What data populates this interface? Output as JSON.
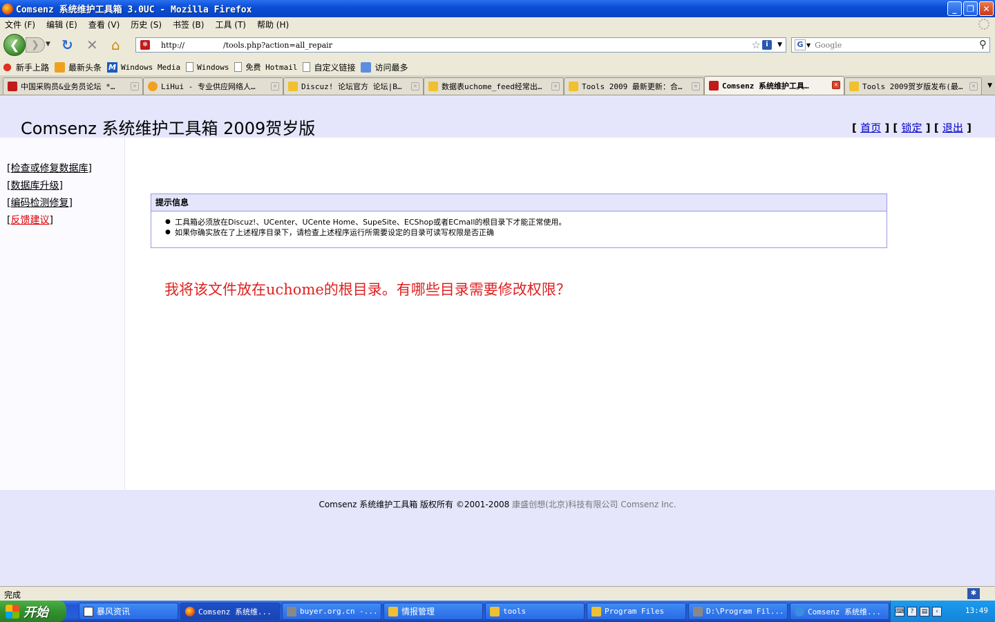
{
  "window": {
    "title": "Comsenz 系统维护工具箱 3.0UC - Mozilla Firefox",
    "buttons": {
      "minimize": "_",
      "maximize": "❐",
      "close": "✕"
    }
  },
  "menu": [
    "文件 (F)",
    "编辑 (E)",
    "查看 (V)",
    "历史 (S)",
    "书签 (B)",
    "工具 (T)",
    "帮助 (H)"
  ],
  "navbar": {
    "url": "http://                /tools.php?action=all_repair",
    "search_placeholder": "Google",
    "search_engine_icon": "G"
  },
  "bookmarks": [
    {
      "label": "新手上路",
      "icon": "red"
    },
    {
      "label": "最新头条",
      "icon": "rss"
    },
    {
      "label": "Windows Media",
      "icon": "wm",
      "mono": true
    },
    {
      "label": "Windows",
      "icon": "page",
      "mono": true
    },
    {
      "label": "免费 Hotmail",
      "icon": "page",
      "mono": true
    },
    {
      "label": "自定义链接",
      "icon": "page"
    },
    {
      "label": "访问最多",
      "icon": "folder"
    }
  ],
  "tabs": [
    {
      "title": "中国采购员&业务员论坛 *…",
      "icon": "dz",
      "active": false
    },
    {
      "title": "LiHui - 专业供应网络人…",
      "icon": "home",
      "active": false
    },
    {
      "title": "Discuz! 论坛官方 论坛|B…",
      "icon": "folder",
      "active": false
    },
    {
      "title": "数据表uchome_feed经常出…",
      "icon": "folder",
      "active": false
    },
    {
      "title": "Tools 2009 最新更新：合…",
      "icon": "folder",
      "active": false
    },
    {
      "title": "Comsenz 系统维护工具…",
      "icon": "dz",
      "active": true
    },
    {
      "title": "Tools 2009贺岁版发布(最…",
      "icon": "folder",
      "active": false
    }
  ],
  "page": {
    "title": "Comsenz 系统维护工具箱 2009贺岁版",
    "top_links": {
      "home": "首页",
      "lock": "锁定",
      "logout": "退出"
    },
    "sidebar": [
      {
        "label": "检查或修复数据库",
        "feedback": false
      },
      {
        "label": "数据库升级",
        "feedback": false
      },
      {
        "label": "编码检测修复",
        "feedback": false
      },
      {
        "label": "反馈建议",
        "feedback": true
      }
    ],
    "notice": {
      "heading": "提示信息",
      "items": [
        "工具箱必须放在Discuz!、UCenter、UCente Home、SupeSite、ECShop或者ECmall的根目录下才能正常使用。",
        "如果你确实放在了上述程序目录下，请检查上述程序运行所需要设定的目录可读写权限是否正确"
      ]
    },
    "annotation": "我将该文件放在uchome的根目录。有哪些目录需要修改权限？",
    "footer": {
      "main": "Comsenz 系统维护工具箱   版权所有 ©2001-2008 ",
      "company": "康盛创想(北京)科技有限公司 Comsenz Inc."
    }
  },
  "status": {
    "text": "完成"
  },
  "taskbar": {
    "start": "开始",
    "tasks": [
      {
        "label": "暴风资讯",
        "icon": "doc",
        "active": false,
        "mono": false
      },
      {
        "label": "Comsenz 系统维...",
        "icon": "ff",
        "active": true,
        "mono": true
      },
      {
        "label": "buyer.org.cn -...",
        "icon": "putty",
        "active": false,
        "mono": true
      },
      {
        "label": "情报管理",
        "icon": "folder",
        "active": false,
        "mono": false
      },
      {
        "label": "tools",
        "icon": "folder",
        "active": false,
        "mono": true
      },
      {
        "label": "Program Files",
        "icon": "folder",
        "active": false,
        "mono": true
      },
      {
        "label": "D:\\Program Fil...",
        "icon": "putty",
        "active": false,
        "mono": true
      },
      {
        "label": "Comsenz 系统维...",
        "icon": "ie",
        "active": false,
        "mono": true
      }
    ],
    "clock": "13:49"
  }
}
